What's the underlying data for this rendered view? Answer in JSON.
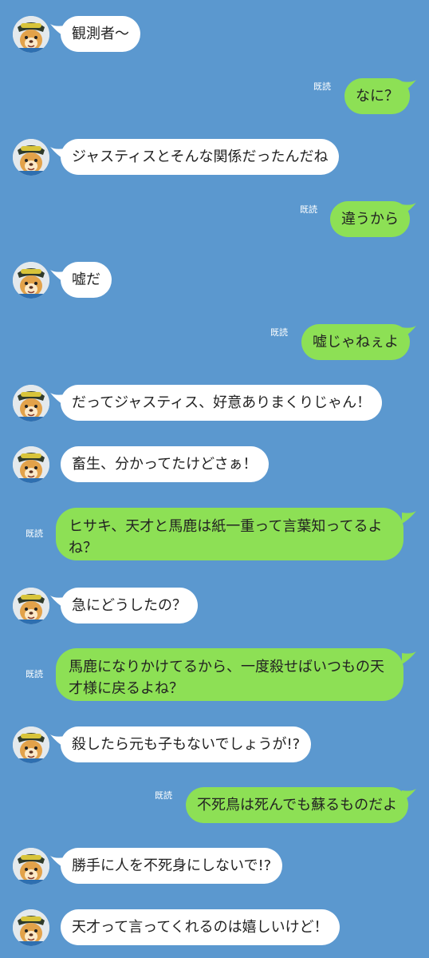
{
  "chat": {
    "read_label": "既読",
    "colors": {
      "background": "#5b98cf",
      "sent_bubble": "#8de055",
      "received_bubble": "#ffffff",
      "read_text": "#ffffff"
    },
    "messages": [
      {
        "side": "left",
        "text": "観測者〜"
      },
      {
        "side": "right",
        "text": "なに？"
      },
      {
        "side": "left",
        "text": "ジャスティスとそんな関係だったんだね"
      },
      {
        "side": "right",
        "text": "違うから"
      },
      {
        "side": "left",
        "text": "嘘だ"
      },
      {
        "side": "right",
        "text": "嘘じゃねぇよ"
      },
      {
        "side": "left",
        "text": "だってジャスティス、好意ありまくりじゃん！"
      },
      {
        "side": "left",
        "text": "畜生、分かってたけどさぁ！"
      },
      {
        "side": "right",
        "text": "ヒサキ、天才と馬鹿は紙一重って言葉知ってるよね？"
      },
      {
        "side": "left",
        "text": "急にどうしたの？"
      },
      {
        "side": "right",
        "text": "馬鹿になりかけてるから、一度殺せばいつもの天才様に戻るよね？"
      },
      {
        "side": "left",
        "text": "殺したら元も子もないでしょうが!?"
      },
      {
        "side": "right",
        "text": "不死鳥は死んでも蘇るものだよ"
      },
      {
        "side": "left",
        "text": "勝手に人を不死身にしないで!?"
      },
      {
        "side": "left",
        "text": "天才って言ってくれるのは嬉しいけど！"
      }
    ]
  }
}
